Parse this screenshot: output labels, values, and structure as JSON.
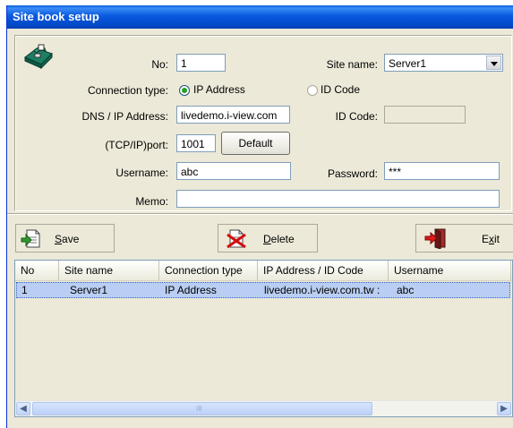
{
  "window": {
    "title": "Site book setup"
  },
  "form": {
    "no_label": "No:",
    "no_value": "1",
    "site_name_label": "Site name:",
    "site_name_value": "Server1",
    "connection_type_label": "Connection type:",
    "radio_ip_label": "IP Address",
    "radio_ip_checked": true,
    "radio_id_label": "ID Code",
    "radio_id_checked": false,
    "dns_label": "DNS / IP Address:",
    "dns_value": "livedemo.i-view.com",
    "id_code_label": "ID Code:",
    "id_code_value": "",
    "port_label": "(TCP/IP)port:",
    "port_value": "1001",
    "default_button": "Default",
    "username_label": "Username:",
    "username_value": "abc",
    "password_label": "Password:",
    "password_value": "***",
    "memo_label": "Memo:",
    "memo_value": ""
  },
  "toolbar": {
    "save_prefix": "S",
    "save_rest": "ave",
    "delete_prefix": "D",
    "delete_rest": "elete",
    "exit_prefix": "E",
    "exit_x": "x",
    "exit_rest": "it"
  },
  "table": {
    "columns": [
      "No",
      "Site name",
      "Connection type",
      "IP Address / ID Code",
      "Username"
    ],
    "rows": [
      {
        "no": "1",
        "site_name": "Server1",
        "connection_type": "IP Address",
        "address": "livedemo.i-view.com.tw :",
        "username": "abc"
      }
    ]
  },
  "scrollbar": {
    "grip_text": "III"
  },
  "colors": {
    "title_bar": "#0a59e0",
    "selected_row": "#b9cef2",
    "window_bg": "#ece9d8"
  },
  "icons": [
    "phone-icon",
    "save-icon",
    "delete-icon",
    "exit-icon",
    "scroll-left-icon",
    "scroll-right-icon"
  ]
}
